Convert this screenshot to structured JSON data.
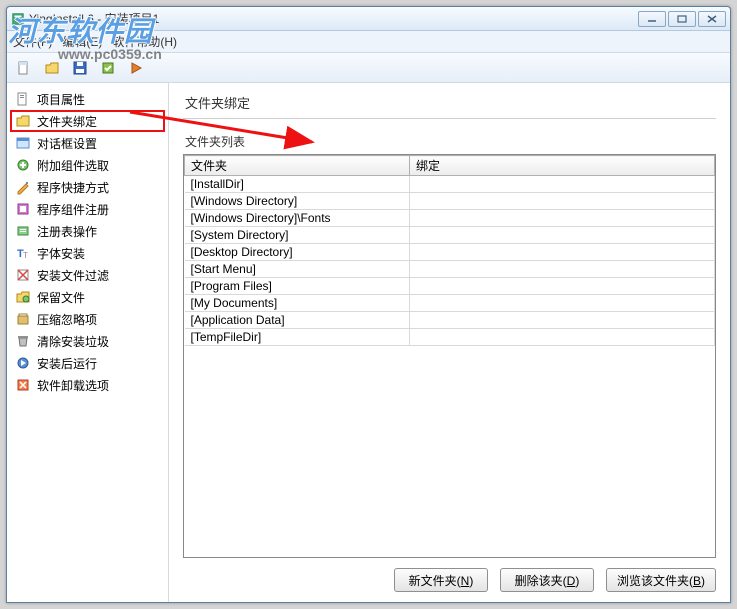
{
  "window": {
    "title": "YingInstall 6 - 安装项目1"
  },
  "menu": {
    "file": "文件(F)",
    "edit": "编辑(E)",
    "help": "软件帮助(H)"
  },
  "sidebar": {
    "items": [
      {
        "label": "项目属性"
      },
      {
        "label": "文件夹绑定"
      },
      {
        "label": "对话框设置"
      },
      {
        "label": "附加组件选取"
      },
      {
        "label": "程序快捷方式"
      },
      {
        "label": "程序组件注册"
      },
      {
        "label": "注册表操作"
      },
      {
        "label": "字体安装"
      },
      {
        "label": "安装文件过滤"
      },
      {
        "label": "保留文件"
      },
      {
        "label": "压缩忽略项"
      },
      {
        "label": "清除安装垃圾"
      },
      {
        "label": "安装后运行"
      },
      {
        "label": "软件卸载选项"
      }
    ],
    "selectedIndex": 1
  },
  "main": {
    "title": "文件夹绑定",
    "list_label": "文件夹列表",
    "columns": {
      "folder": "文件夹",
      "binding": "绑定"
    },
    "rows": [
      {
        "folder": "[InstallDir]",
        "binding": ""
      },
      {
        "folder": "[Windows Directory]",
        "binding": ""
      },
      {
        "folder": "[Windows Directory]\\Fonts",
        "binding": ""
      },
      {
        "folder": "[System Directory]",
        "binding": ""
      },
      {
        "folder": "[Desktop Directory]",
        "binding": ""
      },
      {
        "folder": "[Start Menu]",
        "binding": ""
      },
      {
        "folder": "[Program Files]",
        "binding": ""
      },
      {
        "folder": "[My Documents]",
        "binding": ""
      },
      {
        "folder": "[Application Data]",
        "binding": ""
      },
      {
        "folder": "[TempFileDir]",
        "binding": ""
      }
    ],
    "buttons": {
      "new": "新文件夹(N)",
      "delete": "删除该夹(D)",
      "browse": "浏览该文件夹(B)"
    }
  },
  "watermark": {
    "line1": "河东软件园",
    "line2": "www.pc0359.cn"
  }
}
